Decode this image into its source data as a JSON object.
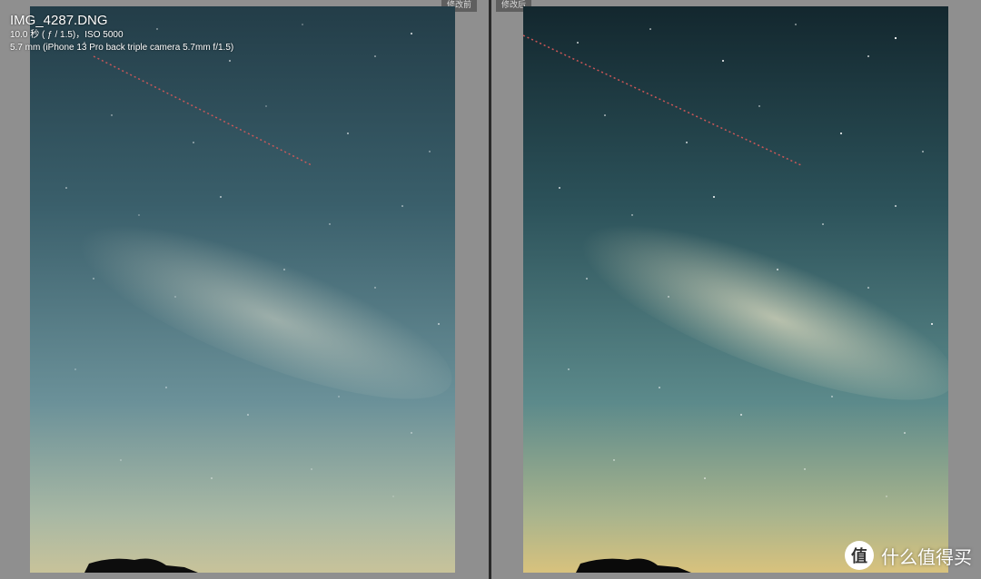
{
  "info": {
    "filename": "IMG_4287.DNG",
    "exposure": "10.0 秒 ( ƒ / 1.5)，ISO 5000",
    "camera": "5.7 mm (iPhone 13 Pro back triple camera 5.7mm f/1.5)"
  },
  "panels": {
    "before_label": "修改前",
    "after_label": "修改后"
  },
  "watermark": {
    "logo_glyph": "值",
    "text": "什么值得买"
  }
}
